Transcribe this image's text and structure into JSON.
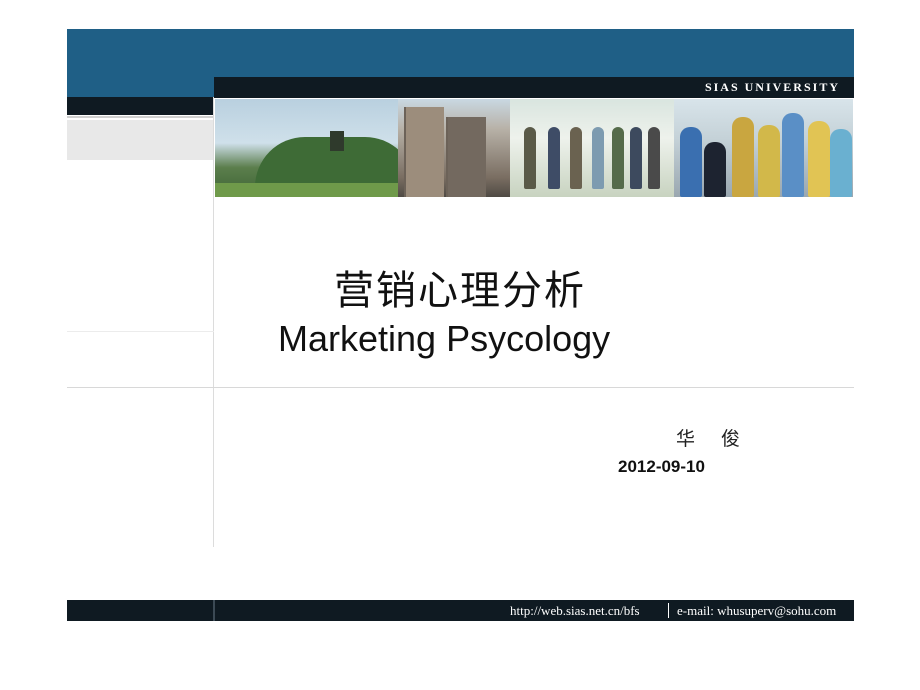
{
  "header": {
    "university": "SIAS UNIVERSITY"
  },
  "title": {
    "chinese": "营销心理分析",
    "english": "Marketing Psycology"
  },
  "author": "华 俊",
  "date": "2012-09-10",
  "footer": {
    "url": "http://web.sias.net.cn/bfs",
    "email": "e-mail: whusuperv@sohu.com"
  },
  "colors": {
    "header_blue": "#1f5f86",
    "dark_band": "#0f1a22"
  }
}
